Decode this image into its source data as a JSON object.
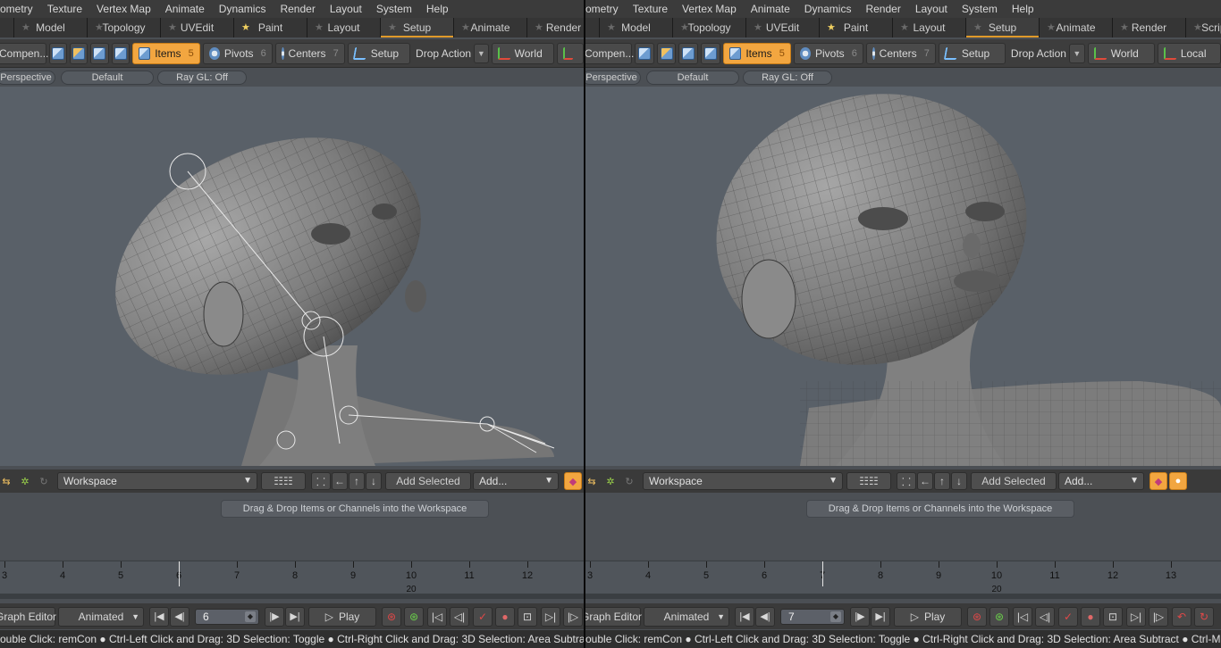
{
  "menu": [
    "ometry",
    "Texture",
    "Vertex Map",
    "Animate",
    "Dynamics",
    "Render",
    "Layout",
    "System",
    "Help"
  ],
  "tabs": [
    {
      "label": "Model",
      "fav": false
    },
    {
      "label": "Topology",
      "fav": false
    },
    {
      "label": "UVEdit",
      "fav": false
    },
    {
      "label": "Paint",
      "fav": true
    },
    {
      "label": "Layout",
      "fav": false
    },
    {
      "label": "Setup",
      "fav": false,
      "active": true
    },
    {
      "label": "Animate",
      "fav": false
    },
    {
      "label": "Render",
      "fav": false
    },
    {
      "label": "Scripting",
      "fav": false
    }
  ],
  "toolbar": {
    "component_label": "Compen...",
    "items_label": "Items",
    "items_count": "5",
    "pivots_label": "Pivots",
    "pivots_count": "6",
    "centers_label": "Centers",
    "centers_count": "7",
    "setup_label": "Setup",
    "drop_action_label": "Drop Action",
    "world_label": "World",
    "local_label": "Local",
    "highlight_color": "#f2a640"
  },
  "viewport": {
    "perspective_label": "Perspective",
    "style_label": "Default",
    "raygl_label": "Ray GL: Off",
    "corner_icon": "+"
  },
  "workspace": {
    "select_label": "Workspace",
    "add_selected_label": "Add Selected",
    "add_label": "Add...",
    "hint": "Drag & Drop Items or Channels into the Workspace"
  },
  "timeline": {
    "left_ticks": [
      "3",
      "4",
      "5",
      "6",
      "7",
      "8",
      "9",
      "10",
      "11",
      "12"
    ],
    "right_ticks": [
      "3",
      "4",
      "5",
      "6",
      "7",
      "8",
      "9",
      "10",
      "11",
      "12",
      "13"
    ],
    "left_current_frame": 6,
    "right_current_frame": 7,
    "range_end": "20"
  },
  "transport": {
    "graph_editor_label": "Graph Editor",
    "animated_label": "Animated",
    "left_frame": "6",
    "right_frame": "7",
    "play_label": "Play"
  },
  "status_left": "ouble Click: remCon ● Ctrl-Left Click and Drag: 3D Selection: Toggle ● Ctrl-Right Click and Drag: 3D Selection: Area Subtract ● Ctrl-Mic",
  "status_right": "ouble Click: remCon ● Ctrl-Left Click and Drag: 3D Selection: Toggle ● Ctrl-Right Click and Drag: 3D Selection: Area Subtract ● Ctrl-Middle Click and"
}
